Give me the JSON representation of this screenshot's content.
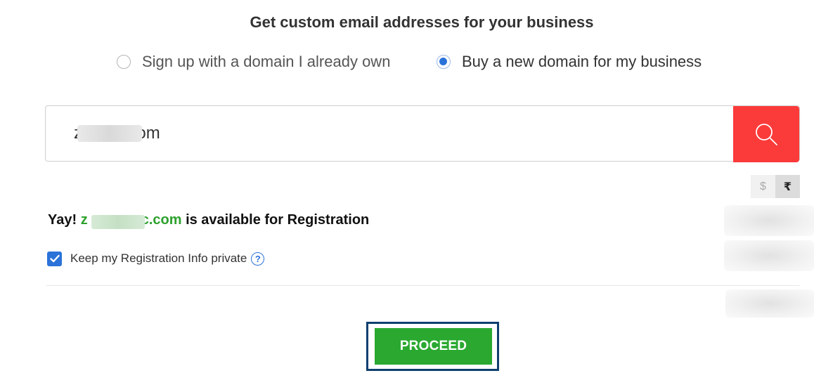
{
  "header": {
    "title": "Get custom email addresses for your business"
  },
  "signup_options": {
    "own_domain_label": "Sign up with a domain I already own",
    "buy_domain_label": "Buy a new domain for my business",
    "selected": "buy_domain"
  },
  "search": {
    "prefix": "z",
    "suffix": "c.com",
    "value": "z       c.com"
  },
  "currency": {
    "usd": "$",
    "inr": "₹",
    "selected": "inr"
  },
  "availability": {
    "prefix": "Yay! ",
    "domain_start": "z",
    "domain_end": "c.com",
    "suffix": " is available for Registration"
  },
  "privacy": {
    "label": "Keep my Registration Info private",
    "checked": true,
    "help": "?"
  },
  "actions": {
    "proceed_label": "PROCEED"
  },
  "colors": {
    "accent_blue": "#2b72d9",
    "search_red": "#fb3a3a",
    "proceed_green": "#2aa830",
    "domain_green": "#2da12d",
    "frame_navy": "#0e3f6f"
  }
}
